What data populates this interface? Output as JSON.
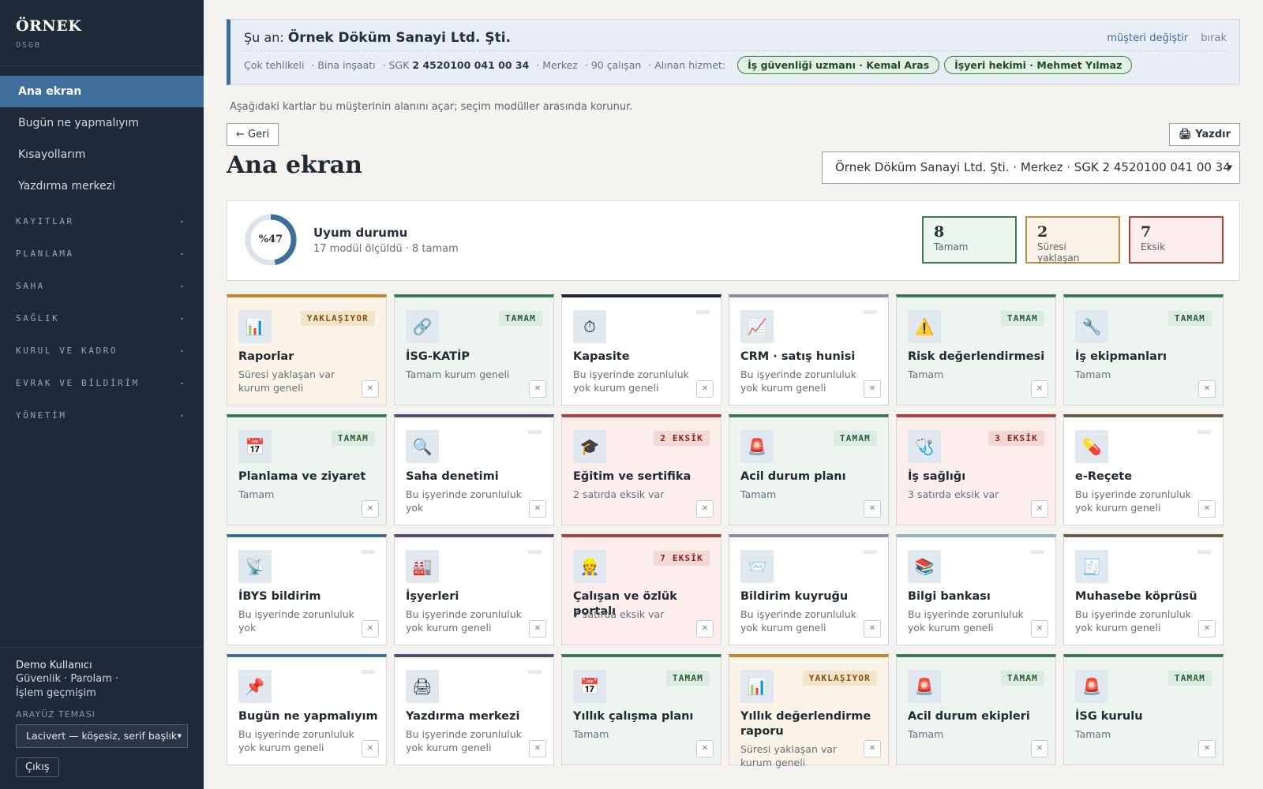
{
  "brand": {
    "name": "ÖRNEK",
    "sub": "OSGB"
  },
  "nav": {
    "items": [
      {
        "label": "Ana ekran",
        "active": true
      },
      {
        "label": "Bugün ne yapmalıyım"
      },
      {
        "label": "Kısayollarım"
      },
      {
        "label": "Yazdırma merkezi"
      }
    ],
    "groups": [
      "KAYITLAR",
      "PLANLAMA",
      "SAHA",
      "SAĞLIK",
      "KURUL VE KADRO",
      "EVRAK VE BİLDİRİM",
      "YÖNETİM"
    ],
    "group_chevron": "▸"
  },
  "user": {
    "name": "Demo Kullanıcı",
    "link_security": "Güvenlik ·",
    "link_password": "Parolam ·",
    "link_history": "İşlem geçmişim",
    "theme_label": "ARAYÜZ TEMASI",
    "theme_value": "Lacivert — köşesiz, serif başlık",
    "logout": "Çıkış"
  },
  "current": {
    "prefix": "Şu an:",
    "company": "Örnek Döküm Sanayi Ltd. Şti.",
    "change_link": "müşteri değiştir",
    "leave_link": "bırak",
    "hazard": "Çok tehlikeli",
    "sector": "· Bina inşaatı",
    "sgk_prefix": "· SGK",
    "sgk": "2 4520100 041 00 34",
    "branch": "· Merkez",
    "employees": "· 90 çalışan",
    "service_label": "· Alınan hizmet:",
    "services": [
      "İş güvenliği uzmanı · Kemal Aras",
      "İşyeri hekimi · Mehmet Yılmaz"
    ]
  },
  "hint": "Aşağıdaki kartlar bu müşterinin alanını açar; seçim modüller arasında korunur.",
  "back_button": "← Geri",
  "print_button": "🖨 Yazdır",
  "page_title": "Ana ekran",
  "customer_select": "Örnek Döküm Sanayi Ltd. Şti. · Merkez · SGK 2 4520100 041 00 34",
  "compliance": {
    "percent_label": "%47",
    "percent": 47,
    "title": "Uyum durumu",
    "subtitle": "17 modül ölçüldü · 8 tamam",
    "stats": [
      {
        "value": "8",
        "label": "Tamam"
      },
      {
        "value": "2",
        "label": "Süresi yaklaşan"
      },
      {
        "value": "7",
        "label": "Eksik"
      }
    ],
    "colors": {
      "ring": "#3d6e9c",
      "track": "#dde3ea"
    }
  },
  "cards": [
    {
      "title": "Raporlar",
      "badge": "YAKLAŞIYOR",
      "status": "warn",
      "accent": "#c9852d",
      "icon": "📊",
      "icon_name": "bar-chart-icon",
      "desc": "Süresi yaklaşan var kurum geneli"
    },
    {
      "title": "İSG-KATİP",
      "badge": "TAMAM",
      "status": "ok",
      "accent": "#3f7b55",
      "icon": "🔗",
      "icon_name": "link-icon",
      "desc": "Tamam kurum geneli"
    },
    {
      "title": "Kapasite",
      "badge": "",
      "status": "none",
      "accent": "#1f2a38",
      "icon": "⏱",
      "icon_name": "stopwatch-icon",
      "desc": "Bu işyerinde zorunluluk yok kurum geneli"
    },
    {
      "title": "CRM · satış hunisi",
      "badge": "",
      "status": "none",
      "accent": "#8a8fa0",
      "icon": "📈",
      "icon_name": "trend-chart-icon",
      "desc": "Bu işyerinde zorunluluk yok kurum geneli"
    },
    {
      "title": "Risk değerlendirmesi",
      "badge": "TAMAM",
      "status": "ok",
      "accent": "#3f7b55",
      "icon": "⚠️",
      "icon_name": "warning-icon",
      "desc": "Tamam"
    },
    {
      "title": "İş ekipmanları",
      "badge": "TAMAM",
      "status": "ok",
      "accent": "#3f7b55",
      "icon": "🔧",
      "icon_name": "wrench-icon",
      "desc": "Tamam"
    },
    {
      "title": "Planlama ve ziyaret",
      "badge": "TAMAM",
      "status": "ok",
      "accent": "#3f7b55",
      "icon": "📅",
      "icon_name": "calendar-icon",
      "desc": "Tamam"
    },
    {
      "title": "Saha denetimi",
      "badge": "",
      "status": "none",
      "accent": "#5a4a7a",
      "icon": "🔍",
      "icon_name": "magnifier-icon",
      "desc": "Bu işyerinde zorunluluk yok"
    },
    {
      "title": "Eğitim ve sertifika",
      "badge": "2 EKSİK",
      "status": "bad",
      "accent": "#b2403c",
      "icon": "🎓",
      "icon_name": "graduation-cap-icon",
      "desc": "2 satırda eksik var"
    },
    {
      "title": "Acil durum planı",
      "badge": "TAMAM",
      "status": "ok",
      "accent": "#3f7b55",
      "icon": "🚨",
      "icon_name": "alarm-light-icon",
      "desc": "Tamam"
    },
    {
      "title": "İş sağlığı",
      "badge": "3 EKSİK",
      "status": "bad",
      "accent": "#b2403c",
      "icon": "🩺",
      "icon_name": "stethoscope-icon",
      "desc": "3 satırda eksik var"
    },
    {
      "title": "e-Reçete",
      "badge": "",
      "status": "none",
      "accent": "#6b5a45",
      "icon": "💊",
      "icon_name": "pill-icon",
      "desc": "Bu işyerinde zorunluluk yok kurum geneli"
    },
    {
      "title": "İBYS bildirim",
      "badge": "",
      "status": "none",
      "accent": "#3d6e9c",
      "icon": "📡",
      "icon_name": "satellite-icon",
      "desc": "Bu işyerinde zorunluluk yok"
    },
    {
      "title": "İşyerleri",
      "badge": "",
      "status": "none",
      "accent": "#5a4a7a",
      "icon": "🏭",
      "icon_name": "factory-icon",
      "desc": "Bu işyerinde zorunluluk yok kurum geneli"
    },
    {
      "title": "Çalışan ve özlük portalı",
      "badge": "7 EKSİK",
      "status": "bad",
      "accent": "#b2403c",
      "icon": "👷",
      "icon_name": "worker-icon",
      "desc": "7 satırda eksik var"
    },
    {
      "title": "Bildirim kuyruğu",
      "badge": "",
      "status": "none",
      "accent": "#8a8fa0",
      "icon": "📨",
      "icon_name": "envelope-icon",
      "desc": "Bu işyerinde zorunluluk yok kurum geneli"
    },
    {
      "title": "Bilgi bankası",
      "badge": "",
      "status": "none",
      "accent": "#8fb3c9",
      "icon": "📚",
      "icon_name": "books-icon",
      "desc": "Bu işyerinde zorunluluk yok kurum geneli"
    },
    {
      "title": "Muhasebe köprüsü",
      "badge": "",
      "status": "none",
      "accent": "#6b5a45",
      "icon": "🧾",
      "icon_name": "receipt-icon",
      "desc": "Bu işyerinde zorunluluk yok kurum geneli"
    },
    {
      "title": "Bugün ne yapmalıyım",
      "badge": "",
      "status": "none",
      "accent": "#3d6e9c",
      "icon": "📌",
      "icon_name": "pin-icon",
      "desc": "Bu işyerinde zorunluluk yok kurum geneli"
    },
    {
      "title": "Yazdırma merkezi",
      "badge": "",
      "status": "none",
      "accent": "#5a4a7a",
      "icon": "🖨",
      "icon_name": "printer-icon",
      "desc": "Bu işyerinde zorunluluk yok kurum geneli"
    },
    {
      "title": "Yıllık çalışma planı",
      "badge": "TAMAM",
      "status": "ok",
      "accent": "#3f7b55",
      "icon": "📅",
      "icon_name": "calendar-icon",
      "desc": "Tamam"
    },
    {
      "title": "Yıllık değerlendirme raporu",
      "badge": "YAKLAŞIYOR",
      "status": "warn",
      "accent": "#c9852d",
      "icon": "📊",
      "icon_name": "bar-chart-icon",
      "desc": "Süresi yaklaşan var kurum geneli"
    },
    {
      "title": "Acil durum ekipleri",
      "badge": "TAMAM",
      "status": "ok",
      "accent": "#3f7b55",
      "icon": "🚨",
      "icon_name": "alarm-light-icon",
      "desc": "Tamam"
    },
    {
      "title": "İSG kurulu",
      "badge": "TAMAM",
      "status": "ok",
      "accent": "#3f7b55",
      "icon": "🚨",
      "icon_name": "alarm-light-icon",
      "desc": "Tamam"
    }
  ],
  "card_close_symbol": "✕"
}
